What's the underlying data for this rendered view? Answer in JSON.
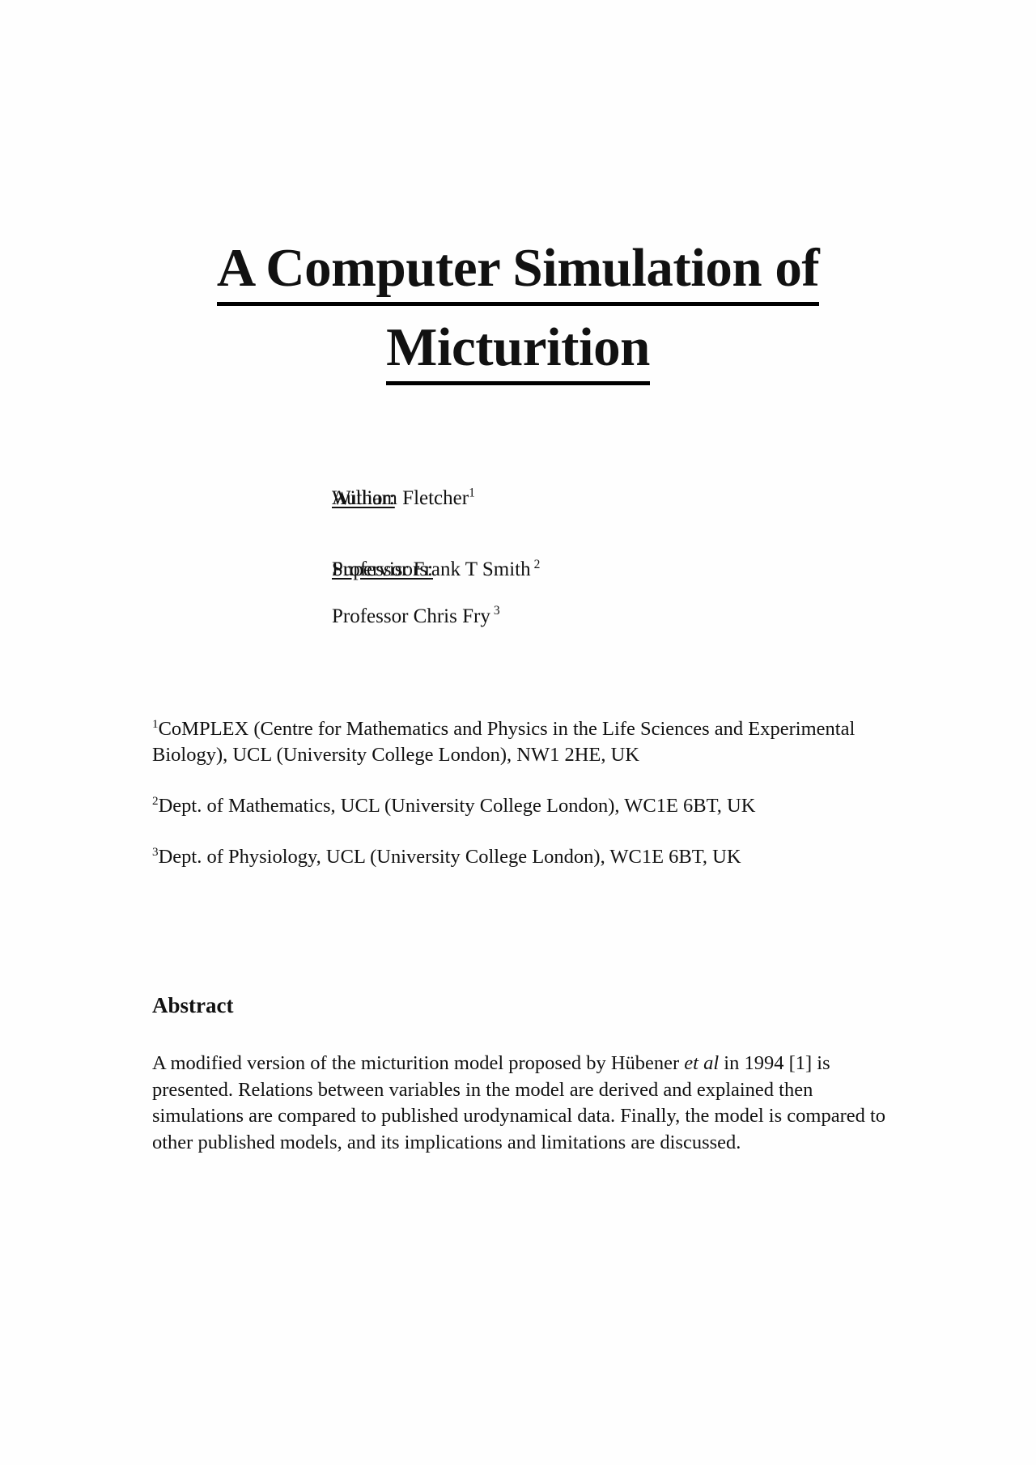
{
  "document": {
    "title_lines": [
      "A Computer Simulation of",
      "Micturition"
    ],
    "credits": [
      {
        "label": "Author:",
        "values": [
          {
            "text": "William Fletcher",
            "sup": "1",
            "sup_spaced": false
          }
        ]
      },
      {
        "label": "Supervisors:",
        "values": [
          {
            "text": "Professor Frank T Smith",
            "sup": "2",
            "sup_spaced": true
          },
          {
            "text": "Professor Chris Fry",
            "sup": "3",
            "sup_spaced": true
          }
        ]
      }
    ],
    "affiliations": [
      {
        "marker": "1",
        "text": "CoMPLEX (Centre for Mathematics and Physics in the Life Sciences and Experimental Biology), UCL (University College London), NW1 2HE, UK"
      },
      {
        "marker": "2",
        "text": "Dept. of Mathematics, UCL (University College London), WC1E 6BT, UK"
      },
      {
        "marker": "3",
        "text": "Dept. of Physiology, UCL (University College London), WC1E 6BT, UK"
      }
    ],
    "abstract": {
      "heading": "Abstract",
      "part1": "A modified version of the micturition model proposed by Hübener ",
      "italic": "et al",
      "part2": " in 1994 [1] is presented. Relations between variables in the model are derived and explained then simulations are compared to published urodynamical data.  Finally, the model is compared to other published models, and its implications and limitations are discussed."
    }
  }
}
